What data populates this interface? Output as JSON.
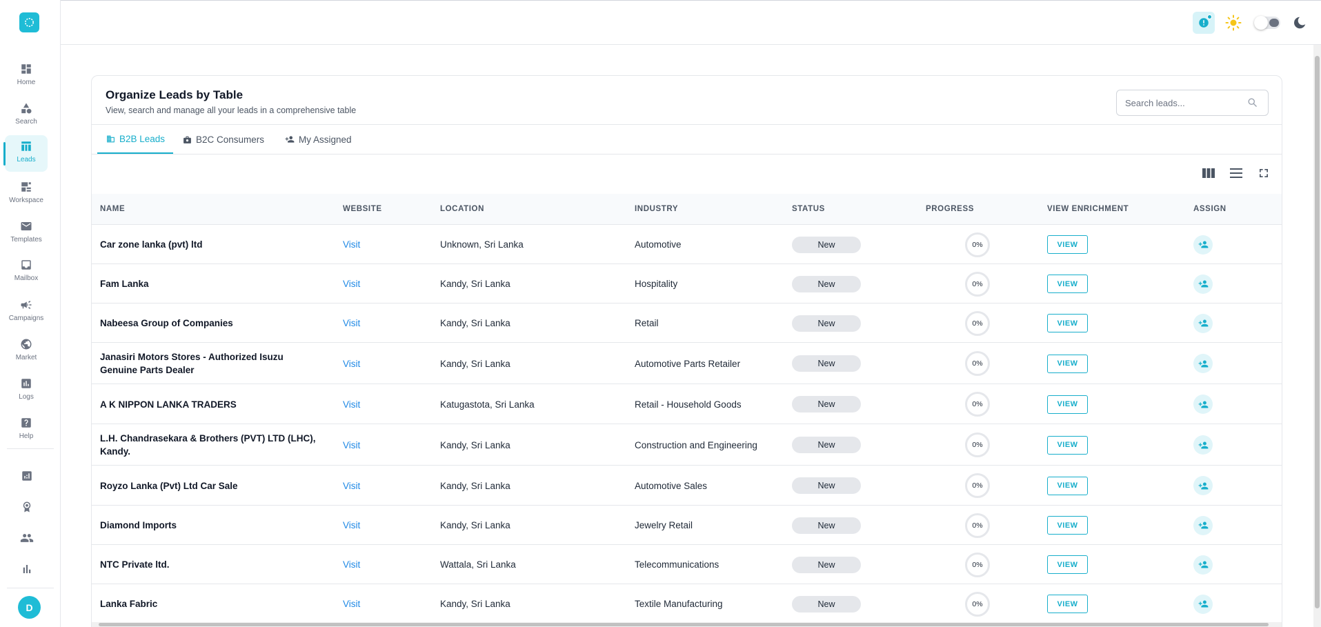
{
  "sidebar": {
    "items": [
      {
        "label": "Home",
        "icon": "dashboard-icon"
      },
      {
        "label": "Search",
        "icon": "shapes-icon"
      },
      {
        "label": "Leads",
        "icon": "table-icon",
        "active": true
      },
      {
        "label": "Workspace",
        "icon": "workspace-icon"
      },
      {
        "label": "Templates",
        "icon": "mail-icon"
      },
      {
        "label": "Mailbox",
        "icon": "inbox-icon"
      },
      {
        "label": "Campaigns",
        "icon": "megaphone-icon"
      },
      {
        "label": "Market",
        "icon": "globe-icon"
      },
      {
        "label": "Logs",
        "icon": "logs-icon"
      },
      {
        "label": "Help",
        "icon": "help-icon"
      }
    ],
    "extra_icons": [
      "analytics-icon",
      "award-icon",
      "people-icon",
      "bar-chart-icon"
    ],
    "avatar_initial": "D"
  },
  "header": {
    "icons": [
      "notification-icon",
      "sun-icon",
      "theme-toggle",
      "moon-icon"
    ]
  },
  "card": {
    "title": "Organize Leads by Table",
    "subtitle": "View, search and manage all your leads in a comprehensive table",
    "search_placeholder": "Search leads..."
  },
  "tabs": [
    {
      "label": "B2B Leads",
      "icon": "building-icon",
      "active": true
    },
    {
      "label": "B2C Consumers",
      "icon": "briefcase-icon",
      "active": false
    },
    {
      "label": "My Assigned",
      "icon": "person-add-icon",
      "active": false
    }
  ],
  "table": {
    "columns": [
      "NAME",
      "WEBSITE",
      "LOCATION",
      "INDUSTRY",
      "STATUS",
      "PROGRESS",
      "VIEW ENRICHMENT",
      "ASSIGN"
    ],
    "visit_label": "Visit",
    "view_label": "VIEW",
    "rows": [
      {
        "name": "Car zone lanka (pvt) ltd",
        "location": "Unknown, Sri Lanka",
        "industry": "Automotive",
        "status": "New",
        "progress": "0%"
      },
      {
        "name": "Fam Lanka",
        "location": "Kandy, Sri Lanka",
        "industry": "Hospitality",
        "status": "New",
        "progress": "0%"
      },
      {
        "name": "Nabeesa Group of Companies",
        "location": "Kandy, Sri Lanka",
        "industry": "Retail",
        "status": "New",
        "progress": "0%"
      },
      {
        "name": "Janasiri Motors Stores - Authorized Isuzu Genuine Parts Dealer",
        "location": "Kandy, Sri Lanka",
        "industry": "Automotive Parts Retailer",
        "status": "New",
        "progress": "0%"
      },
      {
        "name": "A K NIPPON LANKA TRADERS",
        "location": "Katugastota, Sri Lanka",
        "industry": "Retail - Household Goods",
        "status": "New",
        "progress": "0%"
      },
      {
        "name": "L.H. Chandrasekara & Brothers (PVT) LTD (LHC), Kandy.",
        "location": "Kandy, Sri Lanka",
        "industry": "Construction and Engineering",
        "status": "New",
        "progress": "0%"
      },
      {
        "name": "Royzo Lanka (Pvt) Ltd Car Sale",
        "location": "Kandy, Sri Lanka",
        "industry": "Automotive Sales",
        "status": "New",
        "progress": "0%"
      },
      {
        "name": "Diamond Imports",
        "location": "Kandy, Sri Lanka",
        "industry": "Jewelry Retail",
        "status": "New",
        "progress": "0%"
      },
      {
        "name": "NTC Private ltd.",
        "location": "Wattala, Sri Lanka",
        "industry": "Telecommunications",
        "status": "New",
        "progress": "0%"
      },
      {
        "name": "Lanka Fabric",
        "location": "Kandy, Sri Lanka",
        "industry": "Textile Manufacturing",
        "status": "New",
        "progress": "0%"
      }
    ]
  },
  "colors": {
    "accent": "#17aecb",
    "link": "#1e88e5",
    "sun": "#f5c518"
  }
}
